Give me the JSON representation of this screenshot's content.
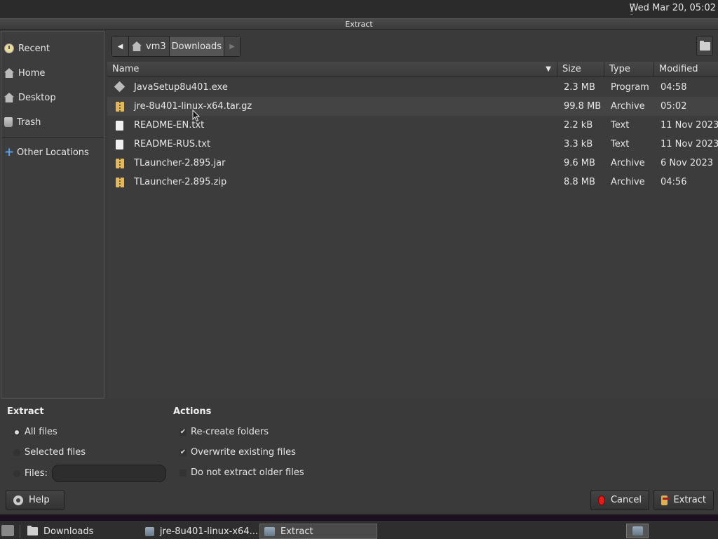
{
  "topbar": {
    "clock": "Wed Mar 20, 05:02"
  },
  "dialog": {
    "title": "Extract"
  },
  "sidebar": {
    "items": [
      {
        "label": "Recent",
        "icon": "recent-icon"
      },
      {
        "label": "Home",
        "icon": "home-icon"
      },
      {
        "label": "Desktop",
        "icon": "desktop-icon"
      },
      {
        "label": "Trash",
        "icon": "trash-icon"
      }
    ],
    "other_locations": {
      "label": "Other Locations",
      "icon": "plus-icon"
    }
  },
  "pathbar": {
    "segments": [
      "vm3",
      "Downloads"
    ],
    "active_segment": "Downloads"
  },
  "file_list": {
    "columns": [
      "Name",
      "Size",
      "Type",
      "Modified"
    ],
    "sorted_by": "Name",
    "rows": [
      {
        "name": "JavaSetup8u401.exe",
        "size": "2.3 MB",
        "type": "Program",
        "modified": "04:58",
        "icon": "executable-icon"
      },
      {
        "name": "jre-8u401-linux-x64.tar.gz",
        "size": "99.8 MB",
        "type": "Archive",
        "modified": "05:02",
        "icon": "archive-icon"
      },
      {
        "name": "README-EN.txt",
        "size": "2.2 kB",
        "type": "Text",
        "modified": "11 Nov 2023",
        "icon": "text-file-icon"
      },
      {
        "name": "README-RUS.txt",
        "size": "3.3 kB",
        "type": "Text",
        "modified": "11 Nov 2023",
        "icon": "text-file-icon"
      },
      {
        "name": "TLauncher-2.895.jar",
        "size": "9.6 MB",
        "type": "Archive",
        "modified": "6 Nov 2023",
        "icon": "archive-icon"
      },
      {
        "name": "TLauncher-2.895.zip",
        "size": "8.8 MB",
        "type": "Archive",
        "modified": "04:56",
        "icon": "archive-icon"
      }
    ],
    "hovered_row": 1
  },
  "extract_options": {
    "title": "Extract",
    "all_files": "All files",
    "selected_files": "Selected files",
    "files": "Files:",
    "files_value": "",
    "selected": "all_files"
  },
  "actions": {
    "title": "Actions",
    "recreate_folders": {
      "label": "Re-create folders",
      "checked": true
    },
    "overwrite_existing": {
      "label": "Overwrite existing files",
      "checked": true
    },
    "do_not_extract_older": {
      "label": "Do not extract older files",
      "checked": false
    }
  },
  "buttons": {
    "help": "Help",
    "cancel": "Cancel",
    "extract": "Extract"
  },
  "taskbar": {
    "items": [
      {
        "label": "Downloads",
        "icon": "folder-icon"
      },
      {
        "label": "jre-8u401-linux-x64...",
        "icon": "archive-manager-icon"
      },
      {
        "label": "Extract",
        "icon": "archive-manager-icon",
        "active": true
      }
    ]
  },
  "colors": {
    "cancel_red": "#e21b1b",
    "folder_yellow": "#e8c47a",
    "background": "#3a3a3a"
  }
}
